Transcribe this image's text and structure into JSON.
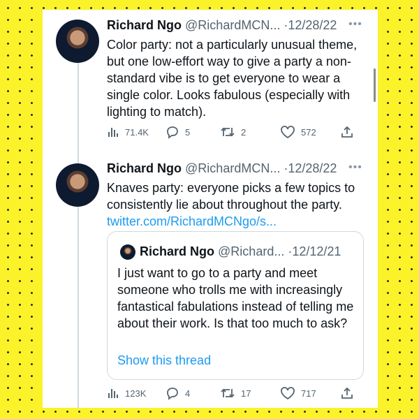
{
  "tweets": [
    {
      "name": "Richard Ngo",
      "handle": "@RichardMCN...",
      "dot": "·",
      "date": "12/28/22",
      "text": "Color party: not a particularly unusual theme, but one low-effort way to give a party a non-standard vibe is to get everyone to wear a single color. Looks fabulous (especially with lighting to match).",
      "stats": {
        "views": "71.4K",
        "replies": "5",
        "retweets": "2",
        "likes": "572"
      }
    },
    {
      "name": "Richard Ngo",
      "handle": "@RichardMCN...",
      "dot": "·",
      "date": "12/28/22",
      "text": "Knaves party: everyone picks a few topics to consistently lie about throughout the party.",
      "link": "twitter.com/RichardMCNgo/s...",
      "quote": {
        "name": "Richard Ngo",
        "handle": "@Richard...",
        "dot": "·",
        "date": "12/12/21",
        "text": "I just want to go to a party and meet someone who trolls me with increasingly fantastical fabulations instead of telling me about their work. Is that too much to ask?",
        "show_thread": "Show this thread"
      },
      "stats": {
        "views": "123K",
        "replies": "4",
        "retweets": "17",
        "likes": "717"
      }
    }
  ],
  "colors": {
    "background": "#fbf22a",
    "link": "#1d9bf0",
    "text": "#0f1419",
    "muted": "#536471"
  }
}
